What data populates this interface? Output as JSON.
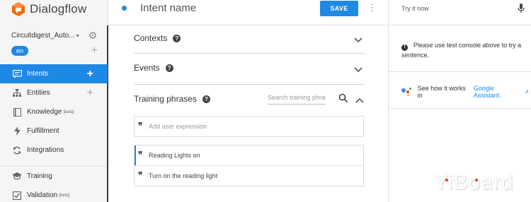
{
  "brand": {
    "name": "Dialogflow"
  },
  "agent": {
    "name": "Circuitdigest_Auto...",
    "language": "en"
  },
  "sidebar": {
    "items": [
      {
        "label": "Intents",
        "icon": "chat-icon",
        "active": true,
        "has_add": true
      },
      {
        "label": "Entities",
        "icon": "hierarchy-icon",
        "active": false,
        "has_add": true
      },
      {
        "label": "Knowledge",
        "sup": "[beta]",
        "icon": "book-icon",
        "active": false
      },
      {
        "label": "Fulfillment",
        "icon": "bolt-icon",
        "active": false
      },
      {
        "label": "Integrations",
        "icon": "sync-icon",
        "active": false
      },
      {
        "label": "Training",
        "icon": "graduation-cap-icon",
        "active": false
      },
      {
        "label": "Validation",
        "sup": "[beta]",
        "icon": "checkbox-icon",
        "active": false
      }
    ]
  },
  "intent": {
    "name": "Intent name",
    "save_label": "SAVE"
  },
  "sections": {
    "contexts": "Contexts",
    "events": "Events",
    "training": "Training phrases",
    "search_placeholder": "Search training phrases"
  },
  "expressions": {
    "add_placeholder": "Add user expression",
    "items": [
      "Reading Lights on",
      "Turn on the reading light"
    ]
  },
  "console": {
    "try_label": "Try it now",
    "info_text": "Please use test console above to try a sentence.",
    "ga_text": "See how it works in",
    "ga_link": "Google Assistant."
  },
  "watermark": {
    "text": "YiBoard"
  },
  "colors": {
    "accent": "#1e88e5",
    "sidebar_bg": "#f5f5f5",
    "logo": "#ef6c00"
  }
}
